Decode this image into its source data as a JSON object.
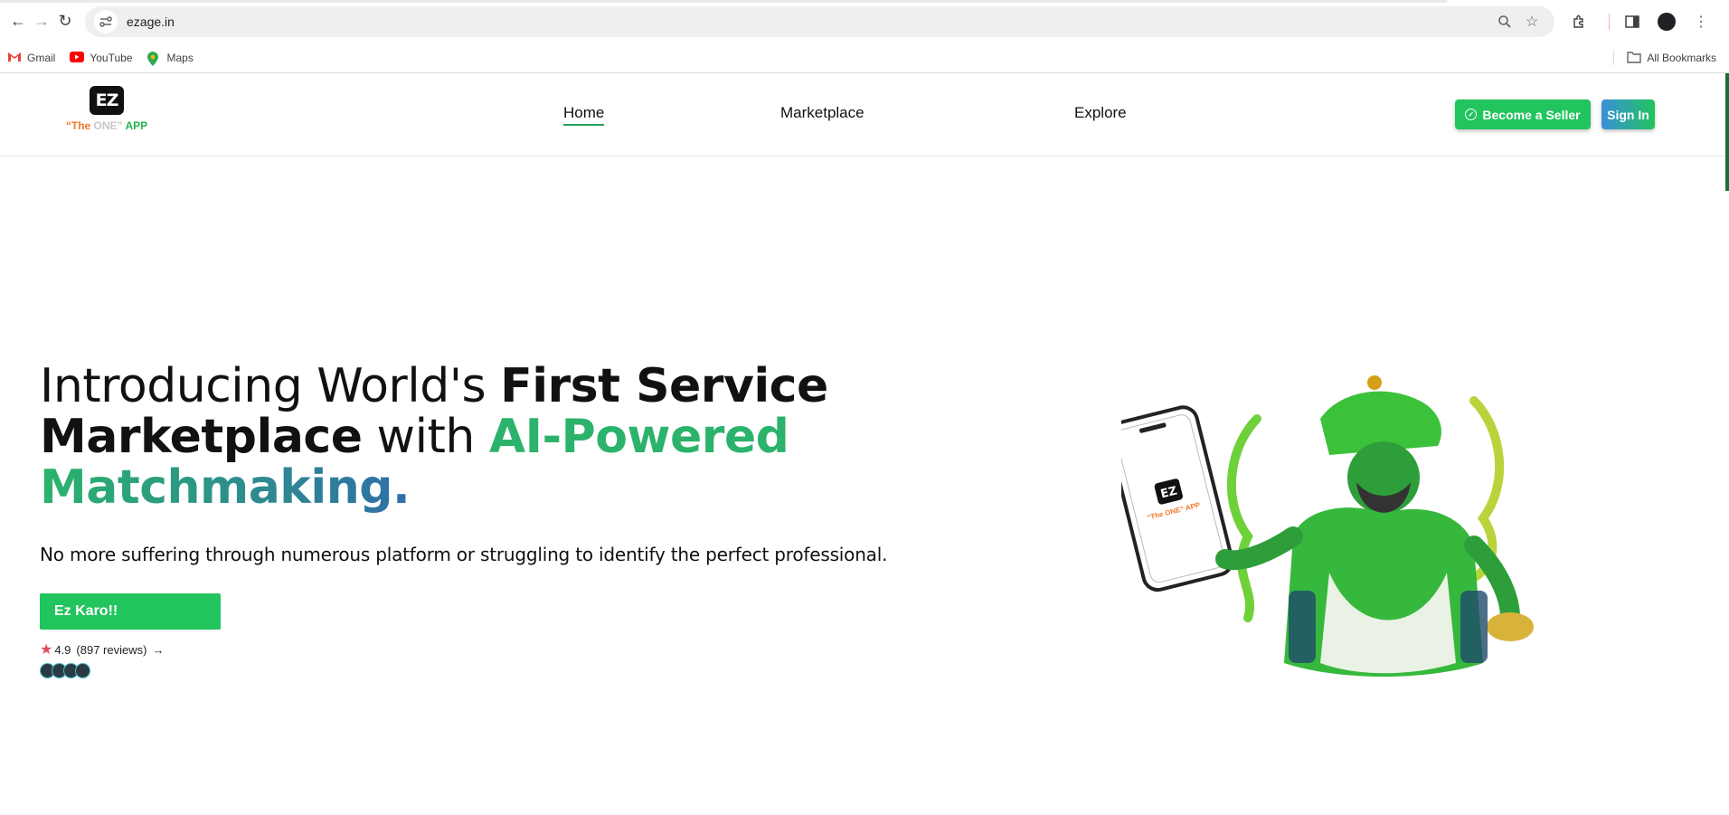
{
  "browser": {
    "url": "ezage.in",
    "bookmarks": [
      "Gmail",
      "YouTube",
      "Maps"
    ],
    "all_bookmarks": "All Bookmarks"
  },
  "site": {
    "logo_mark": "EZ",
    "logo_tag": {
      "quote_open": "“The ",
      "one": "ONE”",
      "app": " APP"
    },
    "nav": [
      "Home",
      "Marketplace",
      "Explore"
    ],
    "active_nav": "Home",
    "become_seller": "Become a Seller",
    "sign_in": "Sign In"
  },
  "hero": {
    "h_part1": "Introducing World's ",
    "h_part2": "First Service",
    "h_part3": "Marketplace",
    "h_part4": " with ",
    "h_part5": "AI-Powered",
    "h_part6": "Matchmaking.",
    "subline": "No more suffering through numerous platform or struggling to identify the perfect professional.",
    "cta": "Ez Karo!!",
    "rating": "4.9",
    "reviews": "(897 reviews)",
    "arrow": "→",
    "phone_logo": "EZ",
    "phone_tag": "“The ONE” APP"
  },
  "colors": {
    "brand_green": "#22c45e",
    "accent_blue": "#2f6fa8",
    "star": "#e54a5c"
  }
}
